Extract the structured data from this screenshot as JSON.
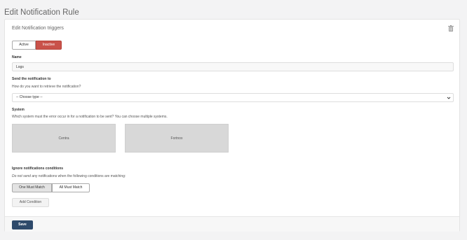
{
  "page": {
    "title": "Edit Notification Rule"
  },
  "card": {
    "title": "Edit Notification triggers",
    "status_toggle": {
      "active_label": "Active",
      "inactive_label": "Inactive",
      "selected": "Inactive"
    }
  },
  "name": {
    "label": "Name",
    "value": "Logs"
  },
  "send_to": {
    "label": "Send the notification to",
    "help": "How do you want to retrieve the notification?",
    "select_value": "-- Choose type --"
  },
  "system": {
    "label": "System",
    "help": "Which system must the error occur in for a notification to be sent? You can choose multiple systems.",
    "options": [
      "Centra",
      "Fortnox"
    ]
  },
  "ignore": {
    "label": "Ignore notifications conditions",
    "help_em": "Do not send",
    "help_rest": " any notifications when the following conditions are matching:",
    "match_one": "One Must Match",
    "match_all": "All Must Match",
    "add_condition": "Add Condition"
  },
  "footer": {
    "save_label": "Save"
  },
  "colors": {
    "inactive": "#c9524a",
    "save": "#2e4a6b"
  },
  "icons": {
    "delete": "trash-icon",
    "select": "chevron-down-icon"
  }
}
